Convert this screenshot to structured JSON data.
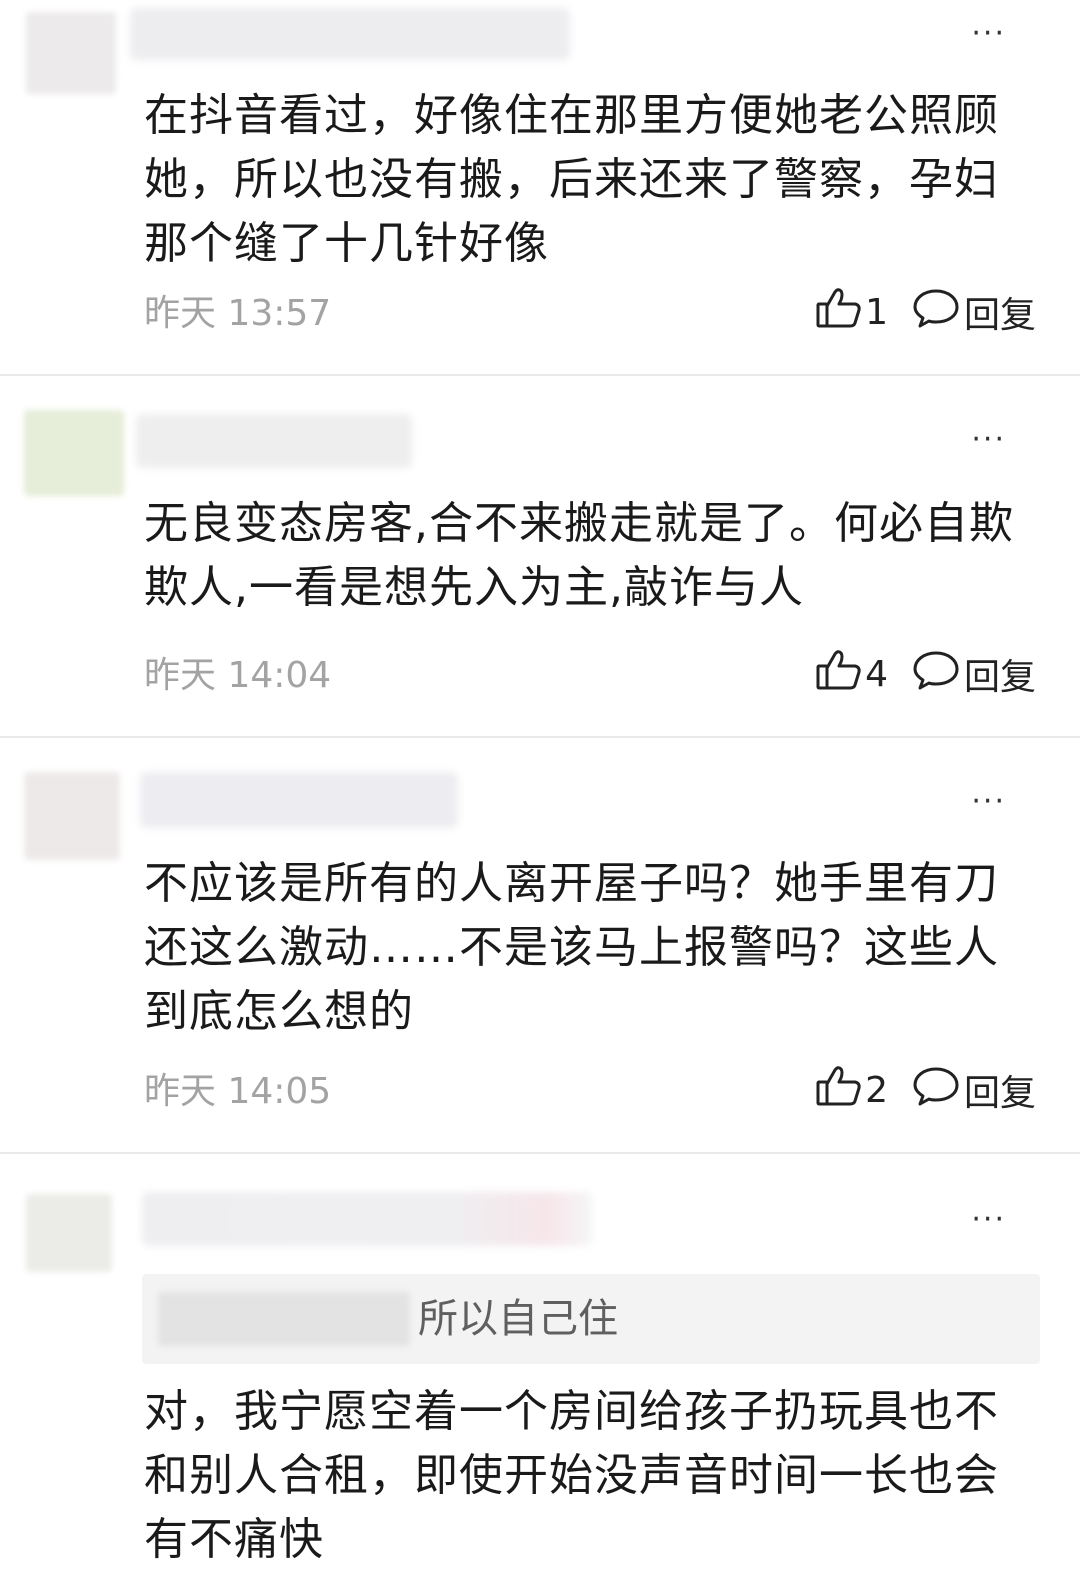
{
  "comments": [
    {
      "text_lines": [
        "在抖音看过，好像住在那里方便她老公照顾",
        "她，所以也没有搬，后来还来了警察，孕妇",
        "那个缝了十几针好像"
      ],
      "time": "昨天 13:57",
      "likes": "1",
      "reply_label": "回复",
      "more_label": "···"
    },
    {
      "text_lines": [
        "无良变态房客,合不来搬走就是了。何必自欺",
        "欺人,一看是想先入为主,敲诈与人"
      ],
      "time": "昨天 14:04",
      "likes": "4",
      "reply_label": "回复",
      "more_label": "···"
    },
    {
      "text_lines": [
        "不应该是所有的人离开屋子吗？她手里有刀",
        "还这么激动……不是该马上报警吗？这些人",
        "到底怎么想的"
      ],
      "time": "昨天 14:05",
      "likes": "2",
      "reply_label": "回复",
      "more_label": "···"
    },
    {
      "quote": "所以自己住",
      "text_lines": [
        "对，我宁愿空着一个房间给孩子扔玩具也不",
        "和别人合租，即使开始没声音时间一长也会",
        "有不痛快"
      ],
      "more_label": "···"
    }
  ],
  "icons": {
    "like": "thumbs-up-icon",
    "reply": "speech-bubble-icon",
    "more": "more-dots-icon"
  },
  "colors": {
    "text": "#1a1a1a",
    "meta": "#a3a3a3",
    "divider": "#e9e9e9",
    "quote_bg": "#f3f3f3"
  }
}
